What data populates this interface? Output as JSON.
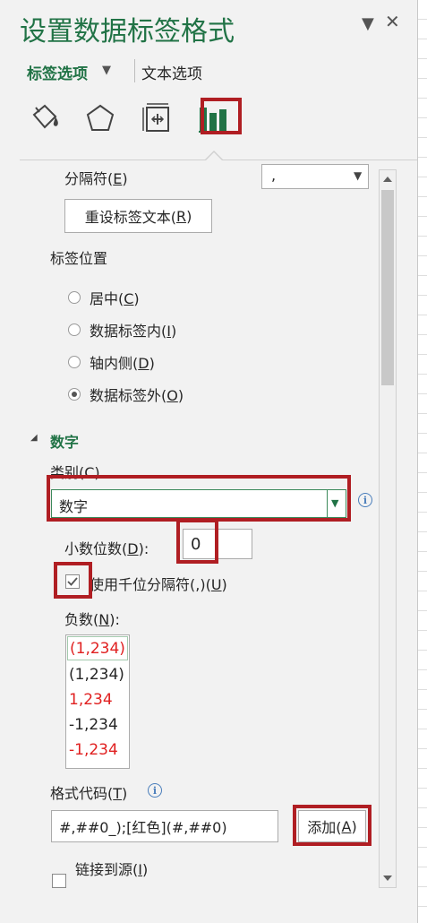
{
  "pane": {
    "title": "设置数据标签格式",
    "collapse_glyph": "▼",
    "close_glyph": "✕"
  },
  "tabs": {
    "label_options": "标签选项",
    "label_options_arrow": "▼",
    "text_options": "文本选项"
  },
  "icons": {
    "fill": "paint-bucket-icon",
    "effects": "pentagon-icon",
    "size": "size-properties-icon",
    "options": "bar-chart-icon"
  },
  "separator": {
    "label": "分隔符(",
    "key": "E",
    "label_end": ")",
    "value": ","
  },
  "reset_button": {
    "label": "重设标签文本(",
    "key": "R",
    "label_end": ")"
  },
  "label_position": {
    "heading": "标签位置",
    "options": [
      {
        "label": "居中(",
        "key": "C",
        "end": ")",
        "checked": false
      },
      {
        "label": "数据标签内(",
        "key": "I",
        "end": ")",
        "checked": false
      },
      {
        "label": "轴内侧(",
        "key": "D",
        "end": ")",
        "checked": false
      },
      {
        "label": "数据标签外(",
        "key": "O",
        "end": ")",
        "checked": true
      }
    ]
  },
  "number": {
    "section_arrow": "◢",
    "section_title": "数字",
    "category_label": "类别(C)",
    "category_value": "数字",
    "decimal_label": "小数位数(",
    "decimal_key": "D",
    "decimal_end": "):",
    "decimal_value": "0",
    "thousands_label": "使用千位分隔符(,)(",
    "thousands_key": "U",
    "thousands_end": ")",
    "thousands_checked": true,
    "negative_label": "负数(",
    "negative_key": "N",
    "negative_end": "):",
    "negative_options": [
      {
        "text": "(1,234)",
        "color": "#e02020",
        "selected": true
      },
      {
        "text": "(1,234)",
        "color": "#262626",
        "selected": false
      },
      {
        "text": "1,234",
        "color": "#e02020",
        "selected": false
      },
      {
        "text": "-1,234",
        "color": "#262626",
        "selected": false
      },
      {
        "text": "-1,234",
        "color": "#e02020",
        "selected": false
      }
    ],
    "format_code_label": "格式代码(",
    "format_code_key": "T",
    "format_code_end": ")",
    "format_code_value": "#,##0_);[红色](#,##0)",
    "add_button": "添加(",
    "add_key": "A",
    "add_end": ")",
    "link_label": "链接到源(",
    "link_key": "I",
    "link_end": ")",
    "link_checked": false
  },
  "info_glyph": "i",
  "colors": {
    "accent": "#217346",
    "highlight": "#b01e23",
    "negative_red": "#e02020"
  }
}
